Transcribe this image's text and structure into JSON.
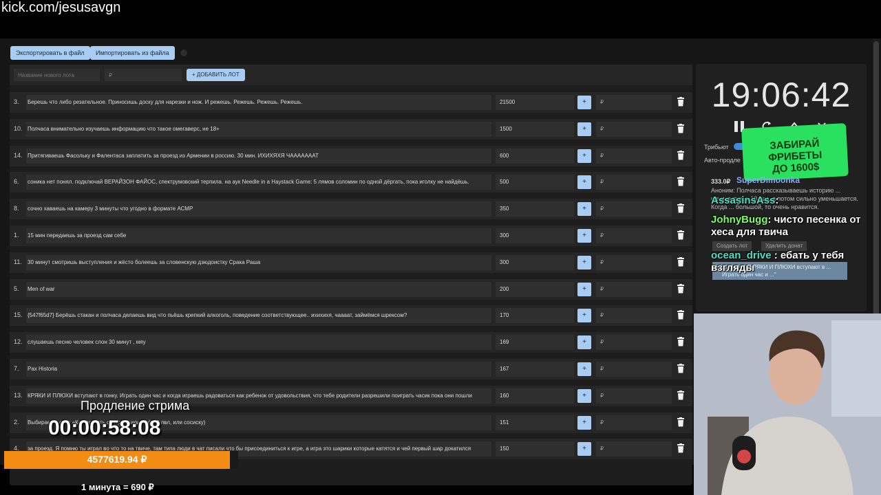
{
  "overlay_url": "kick.com/jesusavgn",
  "toolbar": {
    "export_label": "Экспортировать в файл",
    "import_label": "Импортировать из файла"
  },
  "add_lot": {
    "name_placeholder": "Название нового лота",
    "price_placeholder": "₽",
    "button_label": "+ ДОБАВИТЬ ЛОТ"
  },
  "lots": [
    {
      "num": "3.",
      "title": "Берешь что либо резательное. Приносишь доску для нарезки и нож. И режешь. Режешь. Режешь. Режешь.",
      "amount": "21500",
      "plus": "+",
      "rub": "₽"
    },
    {
      "num": "10.",
      "title": "Полчаса внимательно изучаешь информацию что такое омегаверс, не 18+",
      "amount": "1500",
      "plus": "+",
      "rub": "₽"
    },
    {
      "num": "14.",
      "title": "Притягиваешь Фасольку и Фалентаса заплатить за проезд из Армении в россию. 30 мин. ИХИХЯХЯ ЧАААААААТ",
      "amount": "600",
      "plus": "+",
      "rub": "₽"
    },
    {
      "num": "6.",
      "title": "соника нет понял. подключай ВЕРАЙЗОН ФАЙОС, спектрумовский терпила. на аук Needle in a Haystack Game: 5 лямов соломин по одной дёргать, пока иголку не найдёшь.",
      "amount": "500",
      "plus": "+",
      "rub": "₽"
    },
    {
      "num": "8.",
      "title": "сочно хаваешь на камеру 3 минуты что угодно в формате АСМР",
      "amount": "350",
      "plus": "+",
      "rub": "₽"
    },
    {
      "num": "1.",
      "title": "15 мин передаешь за проезд сам себе",
      "amount": "300",
      "plus": "+",
      "rub": "₽"
    },
    {
      "num": "11.",
      "title": "30 минут смотришь выступления и жёсто болеешь за словенскую дзюдоистку Срака Раша",
      "amount": "300",
      "plus": "+",
      "rub": "₽"
    },
    {
      "num": "5.",
      "title": "Men of war",
      "amount": "200",
      "plus": "+",
      "rub": "₽"
    },
    {
      "num": "15.",
      "title": "{547f65d7} Берёшь стакан и полчаса делаешь вид что пьёшь крепкий алкоголь, поведение соответствующее.. ихихихя, чаааат, займёмся шрексом?",
      "amount": "170",
      "plus": "+",
      "rub": "₽"
    },
    {
      "num": "12.",
      "title": "слушаешь песню человек слон 30 минут , мяу",
      "amount": "169",
      "plus": "+",
      "rub": "₽"
    },
    {
      "num": "7.",
      "title": "Pax Historia",
      "amount": "167",
      "plus": "+",
      "rub": "₽"
    },
    {
      "num": "13.",
      "title": "КРЯКИ И ПЛЮХИ вступают в гонку. Играть один час и когда играешь радоваться как ребенок от удовольствия, что тебе родители разрешили поиграть часик пока они пошли",
      "amount": "160",
      "plus": "+",
      "rub": "₽"
    },
    {
      "num": "2.",
      "title": "Выбираешь сам: «Как достать соседа», или рафт 4 лвл, или сосиску)",
      "amount": "151",
      "plus": "+",
      "rub": "₽"
    },
    {
      "num": "4.",
      "title": "за проезд. Я помню ты играл во что то на твиче, там типа люди в чат писали что бы присоединиться к игре, а игра это шарики которые катятся и чей первый шар докатился",
      "amount": "150",
      "plus": "+",
      "rub": "₽"
    }
  ],
  "timer": {
    "clock": "19:06:42",
    "tribute_label": "Трибьют",
    "auto_extend_label": "Авто-продле"
  },
  "promo": {
    "line1": "ЗАБИРАЙ",
    "line2": "ФРИБЕТЫ",
    "line3": "ДО 1600$"
  },
  "donation": {
    "amount": "333.0₽",
    "name": "SuperDimoonka",
    "text": "Аноним: Полчаса рассказываешь историю ... начинается в 10 раз, а потом сильно уменьшается. Когда ... большой, то очень нравится."
  },
  "chat": [
    {
      "user": "AssasinsAss",
      "sep": ":",
      "text": ""
    },
    {
      "user": "JohnyBugg",
      "sep": ":",
      "text": "чисто песенка от хеса для твича"
    },
    {
      "user": "ocean_drive",
      "sep": ":",
      "text": "ебать у тебя взгляды"
    }
  ],
  "panel_buttons": {
    "create_lot": "Создать лот",
    "delete_donat": "Удалить донат"
  },
  "panel_note": "Добавить \"КРЯКИ И ПЛЮХИ вступают в ... Играть один час и ...\"",
  "extension": {
    "title": "Продление стрима",
    "timer": "00:00:58:08",
    "total": "4577619.94 ₽",
    "rate": "1 минута = 690 ₽"
  }
}
